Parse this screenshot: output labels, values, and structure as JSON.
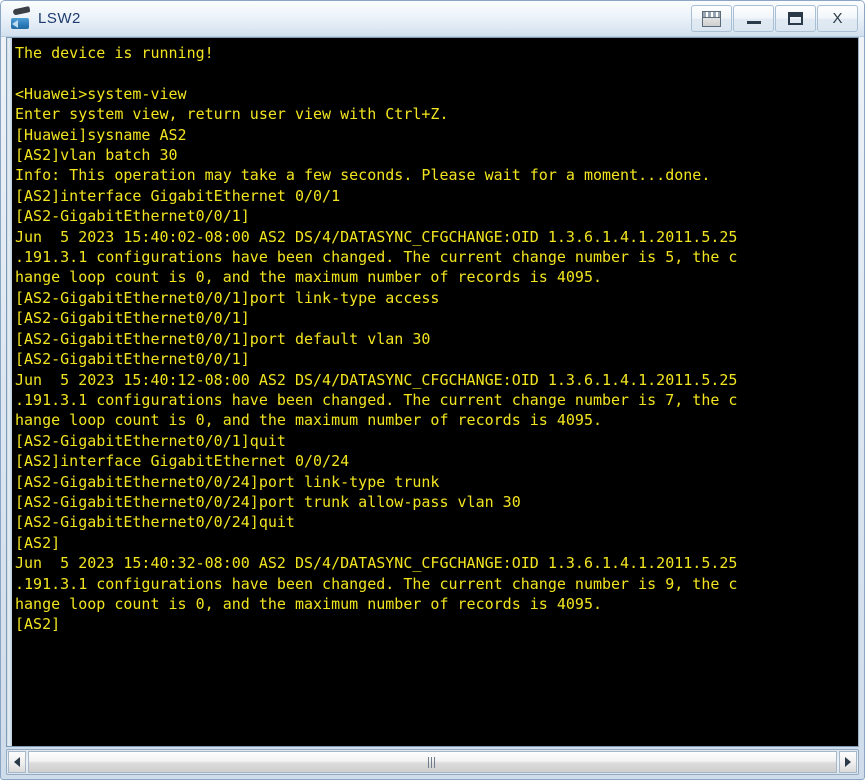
{
  "window": {
    "title": "LSW2",
    "icon": "switch-icon",
    "controls": [
      {
        "name": "panel-button",
        "icon": "panel-icon",
        "label": ""
      },
      {
        "name": "minimize-button",
        "icon": "minimize-icon",
        "label": ""
      },
      {
        "name": "maximize-button",
        "icon": "maximize-icon",
        "label": ""
      },
      {
        "name": "close-button",
        "icon": "close-icon",
        "label": "X"
      }
    ]
  },
  "terminal": {
    "foreground_color": "#f2e520",
    "background_color": "#000000",
    "lines": [
      "The device is running!",
      "",
      "<Huawei>system-view",
      "Enter system view, return user view with Ctrl+Z.",
      "[Huawei]sysname AS2",
      "[AS2]vlan batch 30",
      "Info: This operation may take a few seconds. Please wait for a moment...done.",
      "[AS2]interface GigabitEthernet 0/0/1",
      "[AS2-GigabitEthernet0/0/1]",
      "Jun  5 2023 15:40:02-08:00 AS2 DS/4/DATASYNC_CFGCHANGE:OID 1.3.6.1.4.1.2011.5.25",
      ".191.3.1 configurations have been changed. The current change number is 5, the c",
      "hange loop count is 0, and the maximum number of records is 4095.",
      "[AS2-GigabitEthernet0/0/1]port link-type access",
      "[AS2-GigabitEthernet0/0/1]",
      "[AS2-GigabitEthernet0/0/1]port default vlan 30",
      "[AS2-GigabitEthernet0/0/1]",
      "Jun  5 2023 15:40:12-08:00 AS2 DS/4/DATASYNC_CFGCHANGE:OID 1.3.6.1.4.1.2011.5.25",
      ".191.3.1 configurations have been changed. The current change number is 7, the c",
      "hange loop count is 0, and the maximum number of records is 4095.",
      "[AS2-GigabitEthernet0/0/1]quit",
      "[AS2]interface GigabitEthernet 0/0/24",
      "[AS2-GigabitEthernet0/0/24]port link-type trunk",
      "[AS2-GigabitEthernet0/0/24]port trunk allow-pass vlan 30",
      "[AS2-GigabitEthernet0/0/24]quit",
      "[AS2]",
      "Jun  5 2023 15:40:32-08:00 AS2 DS/4/DATASYNC_CFGCHANGE:OID 1.3.6.1.4.1.2011.5.25",
      ".191.3.1 configurations have been changed. The current change number is 9, the c",
      "hange loop count is 0, and the maximum number of records is 4095.",
      "[AS2]"
    ]
  },
  "scrollbar": {
    "left_arrow_icon": "arrow-left-icon",
    "right_arrow_icon": "arrow-right-icon",
    "orientation": "horizontal",
    "thumb_grip_icon": "grip-icon"
  }
}
